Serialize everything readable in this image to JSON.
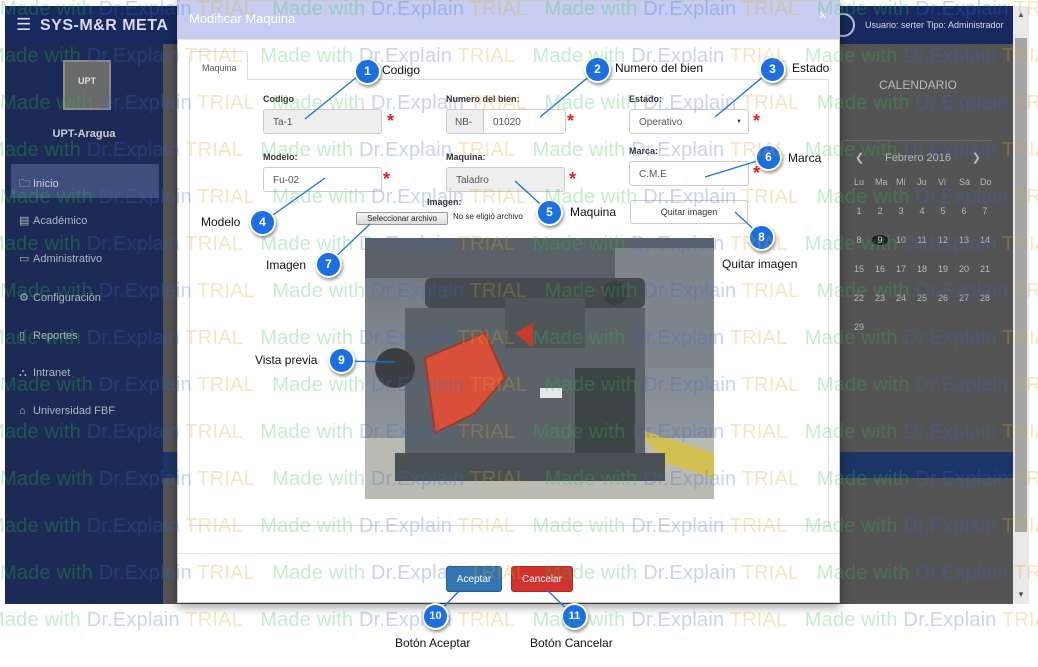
{
  "app": {
    "brand": "SYS-M&R  META",
    "user_info": "Usuario: serter   Tipo: Administrador",
    "org_logo_text": "UPT",
    "org_name": "UPT-Aragua",
    "nav": [
      {
        "label": "Inicio",
        "icon": "folder-icon",
        "glyph": "🗀"
      },
      {
        "label": "Académico",
        "icon": "book-icon",
        "glyph": "▤"
      },
      {
        "label": "Administrativo",
        "icon": "monitor-icon",
        "glyph": "▭"
      },
      {
        "label": "Configuración",
        "icon": "gears-icon",
        "glyph": "⚙"
      },
      {
        "label": "Reportes",
        "icon": "file-icon",
        "glyph": "▯"
      },
      {
        "label": "Intranet",
        "icon": "sitemap-icon",
        "glyph": "⛬"
      },
      {
        "label": "Universidad FBF",
        "icon": "bank-icon",
        "glyph": "⌂"
      }
    ],
    "calendar": {
      "title": "CALENDARIO",
      "month": "Febrero 2016",
      "prev": "❮",
      "next": "❯",
      "days_of_week": [
        "Lu",
        "Ma",
        "Mi",
        "Ju",
        "Vi",
        "Sá",
        "Do"
      ],
      "weeks": [
        [
          "1",
          "2",
          "3",
          "4",
          "5",
          "6",
          "7"
        ],
        [
          "8",
          "9",
          "10",
          "11",
          "12",
          "13",
          "14"
        ],
        [
          "15",
          "16",
          "17",
          "18",
          "19",
          "20",
          "21"
        ],
        [
          "22",
          "23",
          "24",
          "25",
          "26",
          "27",
          "28"
        ],
        [
          "29"
        ]
      ],
      "today": "9"
    }
  },
  "modal": {
    "title": "Modificar Maquina",
    "close": "×",
    "tab": "Maquina",
    "fields": {
      "codigo": {
        "label": "Codigo",
        "value": "Ta-1"
      },
      "numero_bien": {
        "label": "Numero del bien:",
        "prefix": "NB-",
        "value": "01020"
      },
      "estado": {
        "label": "Estado:",
        "value": "Operativo",
        "caret": "▼"
      },
      "modelo": {
        "label": "Modelo:",
        "value": "Fu-02"
      },
      "maquina": {
        "label": "Maquina:",
        "value": "Taladro"
      },
      "marca": {
        "label": "Marca:",
        "value": "C.M.E"
      },
      "imagen": {
        "label": "Imagen:",
        "button": "Seleccionar archivo",
        "status": "No se eligió archivo"
      }
    },
    "required_mark": "*",
    "remove_image": "Quitar imagen",
    "accept": "Aceptar",
    "cancel": "Cancelar"
  },
  "callouts": [
    {
      "number": "1",
      "label": "Codigo"
    },
    {
      "number": "2",
      "label": "Numero del bien"
    },
    {
      "number": "3",
      "label": "Estado"
    },
    {
      "number": "4",
      "label": "Modelo"
    },
    {
      "number": "5",
      "label": "Maquina"
    },
    {
      "number": "6",
      "label": "Marca"
    },
    {
      "number": "7",
      "label": "Imagen"
    },
    {
      "number": "8",
      "label": "Quitar imagen"
    },
    {
      "number": "9",
      "label": "Vista previa"
    },
    {
      "number": "10",
      "label": "Botón Aceptar"
    },
    {
      "number": "11",
      "label": "Botón Cancelar"
    }
  ],
  "watermark": {
    "part_a": "Made with ",
    "part_b": "Dr.Explain",
    "part_c": " TRIAL"
  },
  "colors": {
    "primary": "#3276b1",
    "danger": "#d2322d",
    "marker": "#1c6fe3",
    "required": "#e01f1f"
  }
}
